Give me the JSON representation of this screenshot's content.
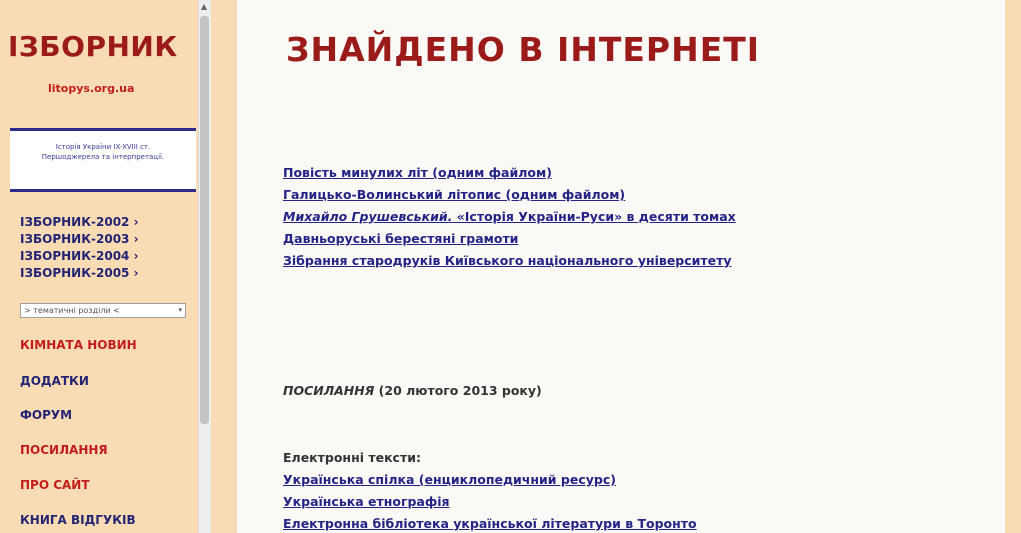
{
  "sidebar": {
    "logo_title": "ІЗБОРНИК",
    "logo_subtitle": "litopys.org.ua",
    "note": "Історія України IX-XVIII ст. Першоджерела та інтерпретації.",
    "izbornyky": [
      "ІЗБОРНИК-2002 ›",
      "ІЗБОРНИК-2003 ›",
      "ІЗБОРНИК-2004 ›",
      "ІЗБОРНИК-2005 ›"
    ],
    "select_value": "> тематичні розділи <",
    "nav": {
      "news": "КІМНАТА НОВИН",
      "addenda": "ДОДАТКИ",
      "forum": "ФОРУМ",
      "links": "ПОСИЛАННЯ",
      "about": "ПРО САЙТ",
      "guestbook": "КНИГА ВІДГУКІВ"
    }
  },
  "main": {
    "title": "ЗНАЙДЕНО В ІНТЕРНЕТІ",
    "links": [
      "Повість минулих літ (одним файлом)",
      "Галицько-Волинський літопис (одним файлом)",
      "Давньоруські берестяні грамоти",
      "Зібрання стародруків Київського національного університету"
    ],
    "hrushevsky_author": "Михайло Грушевський.",
    "hrushevsky_work": " «Історія України-Руси» в десяти томах",
    "posylannia_label": "ПОСИЛАННЯ",
    "posylannia_date": " (20 лютого 2013 року)",
    "etexts_heading": "Електронні тексти:",
    "etext_links": [
      "Українська спілка (енциклопедичний ресурс)",
      "Українська етнографія",
      "Електронна бібліотека української літератури в Торонто"
    ]
  },
  "colors": {
    "sidebar_bg": "#f9dcb4",
    "title_red": "#9b1b1b",
    "nav_red": "#c21d1d",
    "navy": "#242474"
  }
}
